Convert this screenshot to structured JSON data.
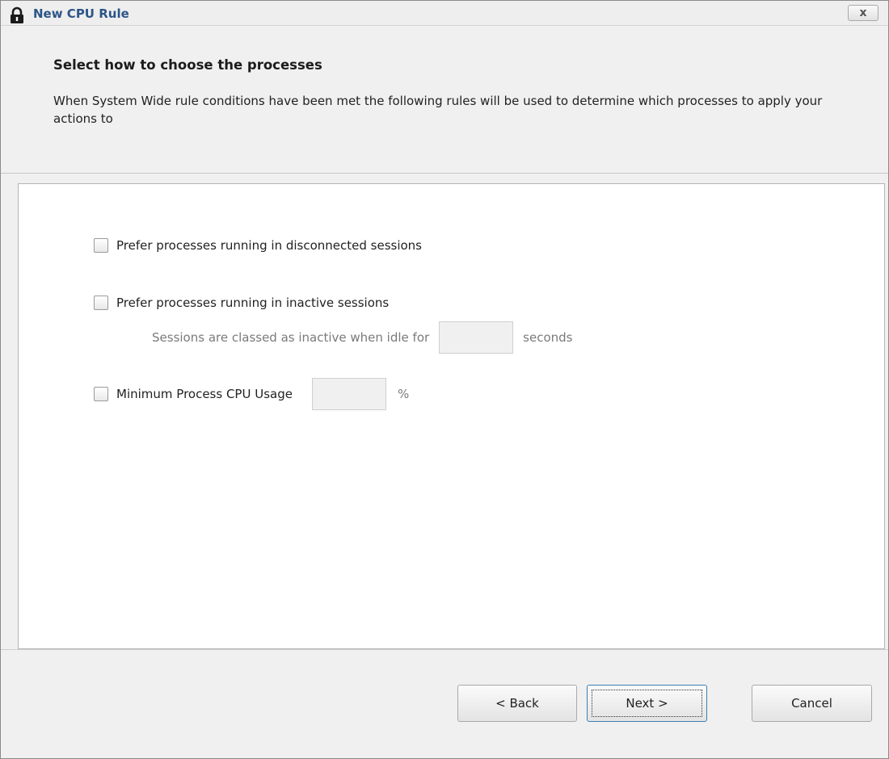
{
  "window": {
    "title": "New CPU Rule",
    "close_label": "x",
    "icon": "padlock-icon"
  },
  "header": {
    "title": "Select how to choose the processes",
    "description": "When System Wide rule conditions have been met the following rules will be used to determine which processes to apply your actions to"
  },
  "options": {
    "disconnected": {
      "label": "Prefer processes running in disconnected sessions",
      "checked": false
    },
    "inactive": {
      "label": "Prefer processes running in inactive sessions",
      "checked": false,
      "idle_prefix": "Sessions are classed as inactive when idle for",
      "idle_value": "",
      "idle_suffix": "seconds"
    },
    "min_cpu": {
      "label": "Minimum Process CPU Usage",
      "checked": false,
      "value": "",
      "unit": "%"
    }
  },
  "buttons": {
    "back": "< Back",
    "next": "Next >",
    "cancel": "Cancel"
  },
  "colors": {
    "title_text": "#2c5588",
    "window_bg": "#f0f0f0",
    "focus_border": "#3c7fb1"
  }
}
